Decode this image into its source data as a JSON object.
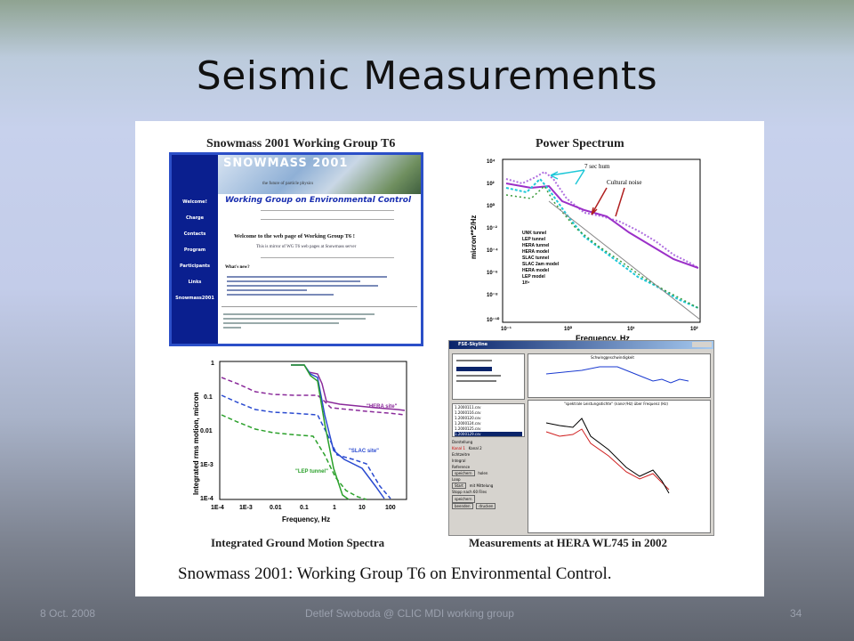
{
  "slide": {
    "title": "Seismic Measurements",
    "footer_left": "8 Oct. 2008",
    "footer_center": "Detlef Swoboda @ CLIC MDI working group",
    "footer_right": "34"
  },
  "figure": {
    "heading_left": "Snowmass 2001 Working Group T6",
    "heading_right": "Power Spectrum",
    "caption_left": "Integrated Ground Motion Spectra",
    "caption_right": "Measurements at HERA WL745 in 2002",
    "footer_caption": "Snowmass 2001: Working Group T6 on Environmental Control."
  },
  "website": {
    "banner_title": "SNOWMASS 2001",
    "banner_sub": "the future of particle physics",
    "group_title": "Working Group on Environmental Control",
    "welcome": "Welcome to the web page of Working Group T6 !",
    "mirror_note": "This is mirror of WG T6 web pages at Snowmass server",
    "whats_new": "What's new?",
    "nav": [
      "Welcome!",
      "Charge",
      "Contacts",
      "Program",
      "Participants",
      "Links",
      "Snowmass2001"
    ]
  },
  "power_spectrum": {
    "ylabel": "micron**2/Hz",
    "xlabel": "Frequency, Hz",
    "yticks": [
      "10⁴",
      "10²",
      "10⁰",
      "10⁻²",
      "10⁻⁴",
      "10⁻⁶",
      "10⁻⁸",
      "10⁻¹⁰"
    ],
    "xticks": [
      "10⁻¹",
      "10⁰",
      "10¹",
      "10²"
    ],
    "annotation_hum": "7 sec hum",
    "annotation_noise": "Cultural noise",
    "legend": [
      "UNK tunnel",
      "LEP tunnel",
      "HERA tunnel",
      "HERA model",
      "SLAC tunnel",
      "SLAC 2am model",
      "HERA model",
      "LEP model",
      "1/f⁴"
    ],
    "colors": {
      "purple": "#9b30c8",
      "cyan": "#20c8d8",
      "green": "#3a9a3a",
      "grey": "#888888"
    }
  },
  "integrated_motion": {
    "ylabel": "Integrated rms motion, micron",
    "xlabel": "Frequency, Hz",
    "yticks": [
      "1",
      "0.1",
      "0.01",
      "1E-3",
      "1E-4"
    ],
    "xticks": [
      "1E-4",
      "1E-3",
      "0.01",
      "0.1",
      "1",
      "10",
      "100"
    ],
    "label_hera": "\"HERA site\"",
    "label_slac": "\"SLAC site\"",
    "label_lep": "\"LEP tunnel\"",
    "colors": {
      "hera": "#8a2a9a",
      "slac": "#2a4ad0",
      "lep": "#2aa02a",
      "black": "#000000"
    }
  },
  "software": {
    "window_title": "FSE-Skyline",
    "top_plot_title": "Schwinggeschwindigkeit",
    "bottom_plot_title": "\"spektrale Leistungsdichte\" (nano²/Hz) über Frequenz (Hz)",
    "group_display": "Darstellung",
    "channel1": "Kanal 1",
    "channel2": "Kanal 2",
    "check_scale": "Echtzeitre",
    "check_integral": "Integral",
    "ref_group": "Reference",
    "btn_save": "speichern",
    "btn_load": "holen",
    "loop_group": "Loop",
    "btn_start": "Start",
    "check_average": "mit Mittelung",
    "btn_stop": "Stopp nach 60 Files",
    "btn_store": "speichern",
    "btn_end": "beenden",
    "btn_print": "drucken",
    "files": [
      "1.2000111.csv",
      "1.2000116.csv",
      "1.2000120.csv",
      "1.2000124.csv",
      "1.2000125.csv",
      "1.2000129.csv"
    ]
  }
}
